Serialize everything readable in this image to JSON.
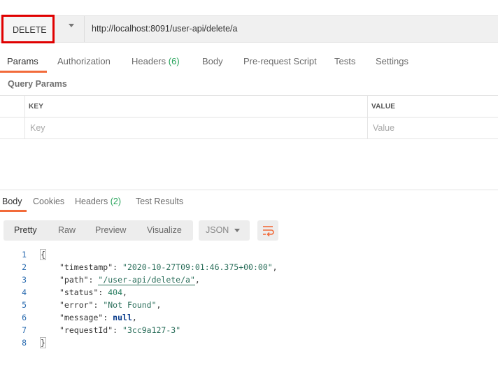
{
  "request": {
    "method": "DELETE",
    "url": "http://localhost:8091/user-api/delete/a"
  },
  "request_tabs": [
    {
      "label": "Params",
      "count": ""
    },
    {
      "label": "Authorization",
      "count": ""
    },
    {
      "label": "Headers",
      "count": "(6)"
    },
    {
      "label": "Body",
      "count": ""
    },
    {
      "label": "Pre-request Script",
      "count": ""
    },
    {
      "label": "Tests",
      "count": ""
    },
    {
      "label": "Settings",
      "count": ""
    }
  ],
  "query_params": {
    "title": "Query Params",
    "columns": [
      "KEY",
      "VALUE"
    ],
    "placeholders": {
      "key": "Key",
      "value": "Value"
    }
  },
  "response_tabs": [
    {
      "label": "Body",
      "count": ""
    },
    {
      "label": "Cookies",
      "count": ""
    },
    {
      "label": "Headers",
      "count": "(2)"
    },
    {
      "label": "Test Results",
      "count": ""
    }
  ],
  "response_view": {
    "modes": [
      "Pretty",
      "Raw",
      "Preview",
      "Visualize"
    ],
    "format": "JSON"
  },
  "response_body": {
    "line_numbers": [
      "1",
      "2",
      "3",
      "4",
      "5",
      "6",
      "7",
      "8"
    ],
    "open_brace": "{",
    "close_brace": "}",
    "fields": [
      {
        "key": "\"timestamp\"",
        "value": "\"2020-10-27T09:01:46.375+00:00\"",
        "trail": ","
      },
      {
        "key": "\"path\"",
        "value": "\"/user-api/delete/a\"",
        "trail": ","
      },
      {
        "key": "\"status\"",
        "value": "404",
        "trail": ","
      },
      {
        "key": "\"error\"",
        "value": "\"Not Found\"",
        "trail": ","
      },
      {
        "key": "\"message\"",
        "value": "null",
        "trail": ","
      },
      {
        "key": "\"requestId\"",
        "value": "\"3cc9a127-3\"",
        "trail": ""
      }
    ]
  },
  "colors": {
    "accent": "#f26b3a",
    "highlight_border": "#e00000",
    "count_green": "#26a35a"
  }
}
